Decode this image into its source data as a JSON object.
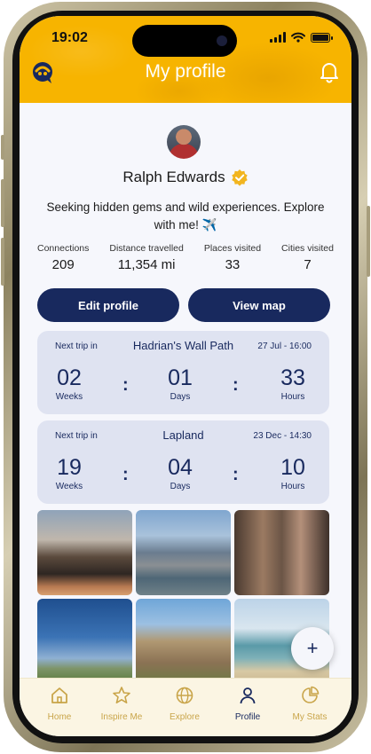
{
  "status_bar": {
    "time": "19:02"
  },
  "header": {
    "title": "My profile",
    "logo_icon": "app-logo-icon",
    "bell_icon": "bell-icon",
    "background_color": "#f7b400"
  },
  "profile": {
    "name": "Ralph Edwards",
    "bio": "Seeking hidden gems and wild experiences. Explore with me! ✈️",
    "stats": [
      {
        "label": "Connections",
        "value": "209"
      },
      {
        "label": "Distance travelled",
        "value": "11,354 mi"
      },
      {
        "label": "Places visited",
        "value": "33"
      },
      {
        "label": "Cities visited",
        "value": "7"
      }
    ]
  },
  "actions": {
    "edit_profile": "Edit profile",
    "view_map": "View map"
  },
  "trips": [
    {
      "next_label": "Next trip in",
      "name": "Hadrian's Wall Path",
      "date": "27 Jul - 16:00",
      "weeks": "02",
      "days": "01",
      "hours": "33",
      "weeks_label": "Weeks",
      "days_label": "Days",
      "hours_label": "Hours"
    },
    {
      "next_label": "Next trip in",
      "name": "Lapland",
      "date": "23 Dec - 14:30",
      "weeks": "19",
      "days": "04",
      "hours": "10",
      "weeks_label": "Weeks",
      "days_label": "Days",
      "hours_label": "Hours"
    }
  ],
  "fab": {
    "label": "+"
  },
  "tabs": [
    {
      "label": "Home",
      "icon": "home-icon"
    },
    {
      "label": "Inspire Me",
      "icon": "star-icon"
    },
    {
      "label": "Explore",
      "icon": "globe-icon"
    },
    {
      "label": "Profile",
      "icon": "person-icon",
      "active": true
    },
    {
      "label": "My Stats",
      "icon": "pie-chart-icon"
    }
  ],
  "colors": {
    "primary": "#18295e",
    "accent": "#f7b400",
    "card": "#dfe3f1",
    "tab_inactive": "#c9a54a"
  }
}
